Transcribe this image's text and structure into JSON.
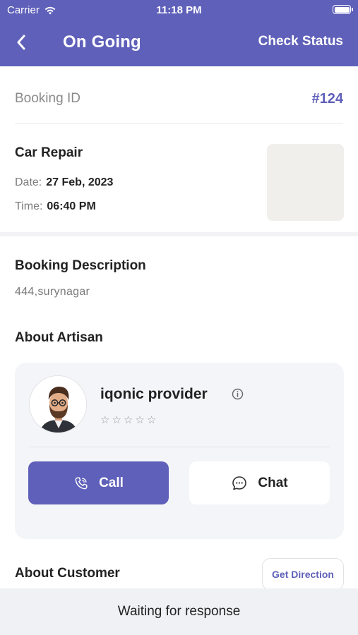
{
  "status_bar": {
    "carrier": "Carrier",
    "time": "11:18 PM"
  },
  "header": {
    "title": "On Going",
    "action_label": "Check Status",
    "back_icon": "chevron-left-icon"
  },
  "booking": {
    "id_label": "Booking ID",
    "id_value": "#124"
  },
  "service": {
    "name": "Car Repair",
    "date_label": "Date:",
    "date_value": "27 Feb, 2023",
    "time_label": "Time:",
    "time_value": "06:40 PM"
  },
  "description": {
    "title": "Booking Description",
    "text": "444,surynagar"
  },
  "artisan": {
    "section_title": "About Artisan",
    "name": "iqonic provider",
    "rating": 0,
    "rating_max": 5,
    "call_label": "Call",
    "chat_label": "Chat"
  },
  "customer": {
    "section_title": "About Customer",
    "direction_label": "Get Direction"
  },
  "footer": {
    "status_text": "Waiting for response"
  },
  "colors": {
    "primary": "#5f60b9",
    "card_bg": "#f4f5f8",
    "footer_bg": "#f0f1f4"
  }
}
